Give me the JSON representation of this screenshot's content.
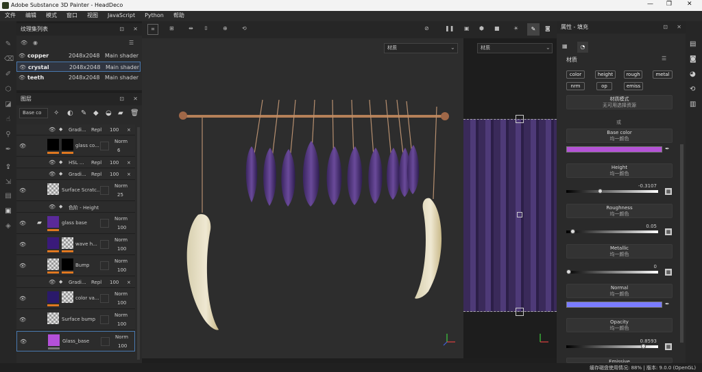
{
  "app": {
    "title": "Adobe Substance 3D Painter - HeadDeco",
    "menus": [
      "文件",
      "编辑",
      "模式",
      "窗口",
      "视图",
      "JavaScript",
      "Python",
      "帮助"
    ]
  },
  "texture_sets": {
    "title": "纹理集列表",
    "rows": [
      {
        "name": "copper",
        "res": "2048x2048",
        "shader": "Main shader"
      },
      {
        "name": "crystal",
        "res": "2048x2048",
        "shader": "Main shader"
      },
      {
        "name": "teeth",
        "res": "2048x2048",
        "shader": "Main shader"
      }
    ]
  },
  "layers": {
    "title": "图层",
    "blend_select": "Base co",
    "items": [
      {
        "kind": "sub",
        "name": "Gradi...",
        "mode": "Repl",
        "val": "100"
      },
      {
        "kind": "layer",
        "name": "glass co...",
        "mode": "Norm",
        "val": "6"
      },
      {
        "kind": "sub",
        "name": "HSL ...",
        "mode": "Repl",
        "val": "100"
      },
      {
        "kind": "sub",
        "name": "Gradi...",
        "mode": "Repl",
        "val": "100"
      },
      {
        "kind": "layer",
        "name": "Surface Scratc...",
        "mode": "Norm",
        "val": "25"
      },
      {
        "kind": "sub",
        "name": "色阶 - Height",
        "mode": "",
        "val": ""
      },
      {
        "kind": "folder",
        "name": "glass base",
        "mode": "Norm",
        "val": "100"
      },
      {
        "kind": "layer",
        "name": "wave h...",
        "mode": "Norm",
        "val": "100"
      },
      {
        "kind": "layer",
        "name": "Bump",
        "mode": "Norm",
        "val": "100"
      },
      {
        "kind": "sub",
        "name": "Gradi...",
        "mode": "Repl",
        "val": "100"
      },
      {
        "kind": "layer",
        "name": "color va...",
        "mode": "Norm",
        "val": "100"
      },
      {
        "kind": "layer",
        "name": "Surface bump",
        "mode": "Norm",
        "val": "100"
      },
      {
        "kind": "layer",
        "name": "Glass_base",
        "mode": "Norm",
        "val": "100"
      }
    ]
  },
  "viewport": {
    "material_dd": "材质",
    "uv_dd": "材质"
  },
  "properties": {
    "title": "属性 - 填充",
    "section": "材质",
    "channels": [
      "color",
      "height",
      "rough",
      "metal",
      "nrm",
      "op",
      "emiss"
    ],
    "mode_title": "材质模式",
    "mode_sub": "无可用选择资源",
    "or": "或",
    "base_color": {
      "label": "Base color",
      "sub": "均一颜色",
      "color": "#b452d6"
    },
    "height": {
      "label": "Height",
      "sub": "均一颜色",
      "value": "-0.3107",
      "level": 0.36
    },
    "roughness": {
      "label": "Roughness",
      "sub": "均一颜色",
      "value": "0.05",
      "level": 0.05
    },
    "metallic": {
      "label": "Metallic",
      "sub": "均一颜色",
      "value": "0",
      "level": 0.0
    },
    "normal": {
      "label": "Normal",
      "sub": "均一颜色",
      "color": "#7a7cff"
    },
    "opacity": {
      "label": "Opacity",
      "sub": "均一颜色",
      "value": "0.8593",
      "level": 0.86
    },
    "emissive": {
      "label": "Emissive"
    }
  },
  "status": {
    "text": "缓存磁盘使用情况: 88% | 版本: 9.0.0 (OpenGL)"
  }
}
